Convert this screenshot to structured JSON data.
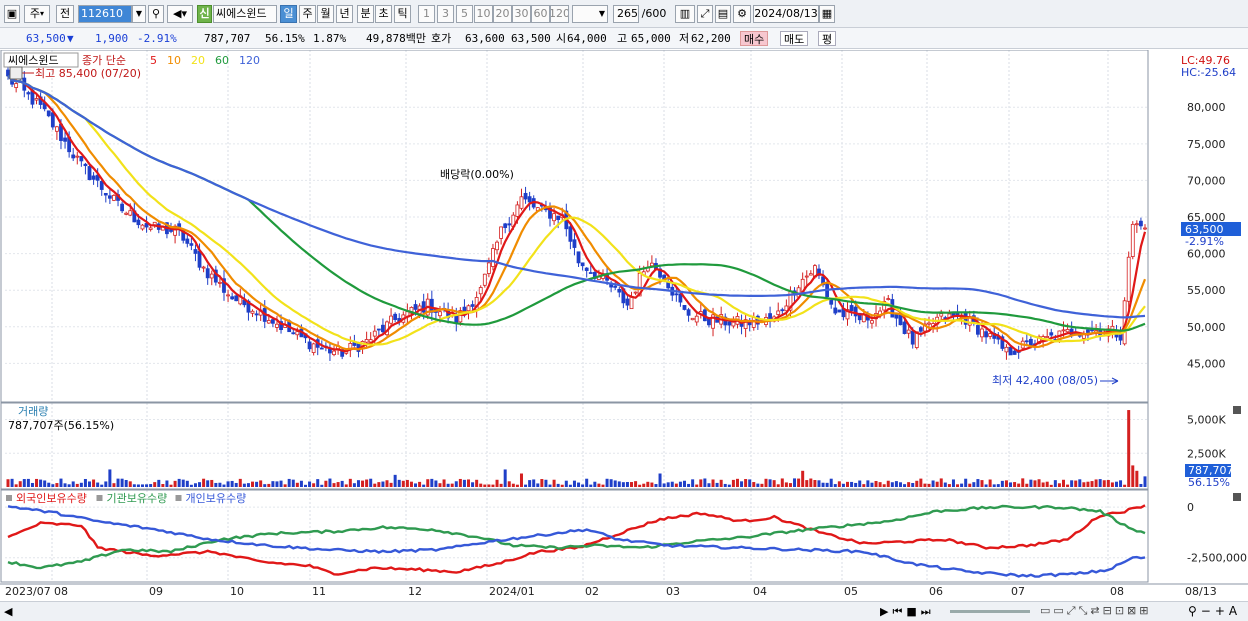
{
  "toolbar": {
    "period_select": "주",
    "prev_label": "전",
    "stock_code": "112610",
    "stock_badge": "신",
    "stock_name": "씨에스윈드",
    "period_tabs": [
      "일",
      "주",
      "월",
      "년",
      "분",
      "초",
      "틱"
    ],
    "interval_buttons": [
      "1",
      "3",
      "5",
      "10",
      "20",
      "30",
      "60",
      "120"
    ],
    "bar_count": "265",
    "bar_max": "/600",
    "date": "2024/08/13"
  },
  "quote": {
    "price": "63,500",
    "change": "1,900",
    "change_pct": "-2.91%",
    "volume": "787,707",
    "vol_ratio": "56.15%",
    "turnover_ratio": "1.87%",
    "trade_value": "49,878백만",
    "ask_label": "호가",
    "ask": "63,600",
    "bid": "63,500",
    "open_label": "시",
    "open": "64,000",
    "high_label": "고",
    "high": "65,000",
    "low_label": "저",
    "low": "62,200",
    "buy_button": "매수",
    "sell_button": "매도",
    "eval_button": "평"
  },
  "legend": {
    "stock": "씨에스윈드",
    "ma_title": "종가 단순",
    "ma_periods": [
      "5",
      "10",
      "20",
      "60",
      "120"
    ],
    "high_marker": "최고 85,400 (07/20)",
    "low_marker": "최저 42,400 (08/05)",
    "dividend_marker": "배당락(0.00%)",
    "lc": "LC:49.76",
    "hc": "HC:-25.64",
    "last_price_tag": "63,500",
    "last_pct_tag": "-2.91%"
  },
  "volume_panel": {
    "title": "거래량",
    "readout": "787,707주(56.15%)",
    "last_tag": "787,707",
    "last_pct": "56.15%"
  },
  "holding_panel": {
    "series_labels": [
      "외국인보유수량",
      "기관보유수량",
      "개인보유수량"
    ]
  },
  "colors": {
    "up": "#d42020",
    "down": "#1f3fc8",
    "ma5": "#e01818",
    "ma10": "#f08c00",
    "ma20": "#f2e21a",
    "ma60": "#1f9a3c",
    "ma120": "#3f62d8",
    "foreign": "#e01818",
    "institution": "#2f9a50",
    "individual": "#3658d8"
  },
  "chart_data": [
    {
      "type": "candlestick",
      "title": "씨에스윈드",
      "x_ticks": [
        "2023/07",
        "08",
        "09",
        "10",
        "11",
        "12",
        "2024/01",
        "02",
        "03",
        "04",
        "05",
        "06",
        "07",
        "08",
        "08/13"
      ],
      "y_ticks": [
        45000,
        50000,
        55000,
        60000,
        65000,
        70000,
        75000,
        80000
      ],
      "ylim": [
        40000,
        87000
      ],
      "close_path": [
        [
          0,
          84000
        ],
        [
          8,
          80000
        ],
        [
          18,
          72000
        ],
        [
          28,
          66000
        ],
        [
          35,
          63500
        ],
        [
          42,
          63000
        ],
        [
          48,
          58000
        ],
        [
          55,
          54000
        ],
        [
          62,
          52000
        ],
        [
          70,
          49000
        ],
        [
          77,
          47000
        ],
        [
          82,
          46500
        ],
        [
          88,
          48000
        ],
        [
          95,
          51000
        ],
        [
          103,
          53000
        ],
        [
          110,
          51000
        ],
        [
          116,
          55000
        ],
        [
          121,
          63000
        ],
        [
          126,
          67500
        ],
        [
          130,
          66000
        ],
        [
          136,
          65000
        ],
        [
          140,
          59000
        ],
        [
          147,
          56000
        ],
        [
          152,
          53000
        ],
        [
          157,
          59000
        ],
        [
          161,
          57000
        ],
        [
          166,
          52000
        ],
        [
          172,
          51000
        ],
        [
          180,
          50500
        ],
        [
          188,
          51000
        ],
        [
          194,
          56000
        ],
        [
          198,
          58000
        ],
        [
          203,
          52000
        ],
        [
          210,
          51000
        ],
        [
          216,
          53000
        ],
        [
          222,
          48000
        ],
        [
          228,
          51000
        ],
        [
          234,
          51500
        ],
        [
          240,
          49000
        ],
        [
          245,
          46500
        ],
        [
          250,
          47500
        ],
        [
          256,
          48500
        ],
        [
          262,
          49500
        ],
        [
          270,
          49500
        ],
        [
          273,
          49000
        ],
        [
          276,
          64000
        ],
        [
          279,
          63500
        ]
      ],
      "bars": 280,
      "series": [
        {
          "name": "5",
          "ma_period": 5
        },
        {
          "name": "10",
          "ma_period": 10
        },
        {
          "name": "20",
          "ma_period": 20
        },
        {
          "name": "60",
          "ma_period": 60
        },
        {
          "name": "120",
          "ma_period": 120
        }
      ]
    },
    {
      "type": "bar",
      "title": "거래량",
      "y_ticks": [
        2500000,
        5000000
      ],
      "y_tick_labels": [
        "2,500K",
        "5,000K"
      ],
      "ylim": [
        0,
        6000000
      ],
      "typical_volume": 400000,
      "spikes": [
        [
          25,
          1300000
        ],
        [
          95,
          900000
        ],
        [
          122,
          1300000
        ],
        [
          126,
          1000000
        ],
        [
          160,
          1000000
        ],
        [
          195,
          1200000
        ],
        [
          275,
          5700000
        ],
        [
          276,
          1600000
        ],
        [
          277,
          1200000
        ],
        [
          279,
          787707
        ]
      ]
    },
    {
      "type": "line",
      "title": "외국인보유수량 / 기관보유수량 / 개인보유수량",
      "y_ticks": [
        0,
        -2500000
      ],
      "y_tick_labels": [
        "0",
        "-2,500,000"
      ],
      "ylim": [
        -3600000,
        700000
      ],
      "series": [
        {
          "name": "외국인보유수량",
          "points": [
            [
              0,
              -1500000
            ],
            [
              8,
              -800000
            ],
            [
              18,
              -900000
            ],
            [
              22,
              -2000000
            ],
            [
              35,
              -2400000
            ],
            [
              50,
              -2200000
            ],
            [
              62,
              -2700000
            ],
            [
              74,
              -2900000
            ],
            [
              80,
              -3300000
            ],
            [
              90,
              -3000000
            ],
            [
              102,
              -3100000
            ],
            [
              110,
              -3200000
            ],
            [
              120,
              -2800000
            ],
            [
              130,
              -2200000
            ],
            [
              140,
              -2000000
            ],
            [
              150,
              -1300000
            ],
            [
              160,
              -600000
            ],
            [
              170,
              -300000
            ],
            [
              180,
              -700000
            ],
            [
              188,
              -500000
            ],
            [
              200,
              -1300000
            ],
            [
              210,
              -1800000
            ],
            [
              220,
              -1700000
            ],
            [
              230,
              -1600000
            ],
            [
              240,
              -2000000
            ],
            [
              250,
              -1900000
            ],
            [
              260,
              -1600000
            ],
            [
              268,
              -400000
            ],
            [
              274,
              -200000
            ],
            [
              279,
              100000
            ]
          ]
        },
        {
          "name": "기관보유수량",
          "points": [
            [
              0,
              -2700000
            ],
            [
              8,
              -3000000
            ],
            [
              18,
              -2700000
            ],
            [
              28,
              -2100000
            ],
            [
              40,
              -2200000
            ],
            [
              52,
              -1600000
            ],
            [
              65,
              -1300000
            ],
            [
              80,
              -1200000
            ],
            [
              92,
              -1000000
            ],
            [
              104,
              -1100000
            ],
            [
              116,
              -1500000
            ],
            [
              124,
              -1900000
            ],
            [
              134,
              -2000000
            ],
            [
              144,
              -1900000
            ],
            [
              156,
              -2000000
            ],
            [
              168,
              -1700000
            ],
            [
              180,
              -1500000
            ],
            [
              192,
              -1200000
            ],
            [
              206,
              -900000
            ],
            [
              216,
              -700000
            ],
            [
              228,
              -200000
            ],
            [
              242,
              0
            ],
            [
              258,
              0
            ],
            [
              268,
              -200000
            ],
            [
              274,
              -900000
            ],
            [
              279,
              -1300000
            ]
          ]
        },
        {
          "name": "개인보유수량",
          "points": [
            [
              0,
              50000
            ],
            [
              12,
              -300000
            ],
            [
              22,
              -700000
            ],
            [
              36,
              -1100000
            ],
            [
              50,
              -1600000
            ],
            [
              64,
              -1900000
            ],
            [
              78,
              -2100000
            ],
            [
              92,
              -2200000
            ],
            [
              106,
              -2100000
            ],
            [
              118,
              -1700000
            ],
            [
              130,
              -1400000
            ],
            [
              142,
              -1100000
            ],
            [
              150,
              -1600000
            ],
            [
              162,
              -1900000
            ],
            [
              178,
              -2000000
            ],
            [
              194,
              -2100000
            ],
            [
              210,
              -2200000
            ],
            [
              222,
              -2800000
            ],
            [
              236,
              -3200000
            ],
            [
              250,
              -3400000
            ],
            [
              262,
              -3300000
            ],
            [
              270,
              -3100000
            ],
            [
              276,
              -2500000
            ],
            [
              279,
              -2500000
            ]
          ]
        }
      ]
    }
  ]
}
